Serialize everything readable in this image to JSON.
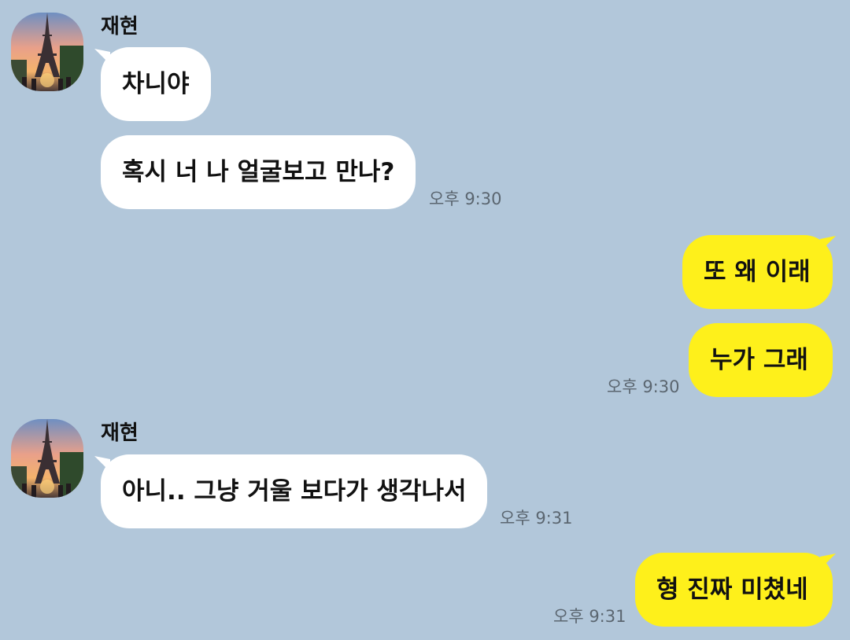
{
  "colors": {
    "background": "#b2c7da",
    "incoming_bubble": "#ffffff",
    "outgoing_bubble": "#fef01b",
    "time_text": "#5b6670"
  },
  "messages": [
    {
      "sender": "재현",
      "avatar_icon": "eiffel-tower-photo-icon",
      "bubbles": [
        "차니야",
        "혹시 너 나 얼굴보고 만나?"
      ],
      "time": "오후 9:30",
      "direction": "incoming"
    },
    {
      "bubbles": [
        "또 왜 이래",
        "누가 그래"
      ],
      "time": "오후 9:30",
      "direction": "outgoing"
    },
    {
      "sender": "재현",
      "avatar_icon": "eiffel-tower-photo-icon",
      "bubbles": [
        "아니.. 그냥 거울 보다가 생각나서"
      ],
      "time": "오후 9:31",
      "direction": "incoming"
    },
    {
      "bubbles": [
        "형 진짜 미쳤네"
      ],
      "time": "오후 9:31",
      "direction": "outgoing"
    }
  ]
}
